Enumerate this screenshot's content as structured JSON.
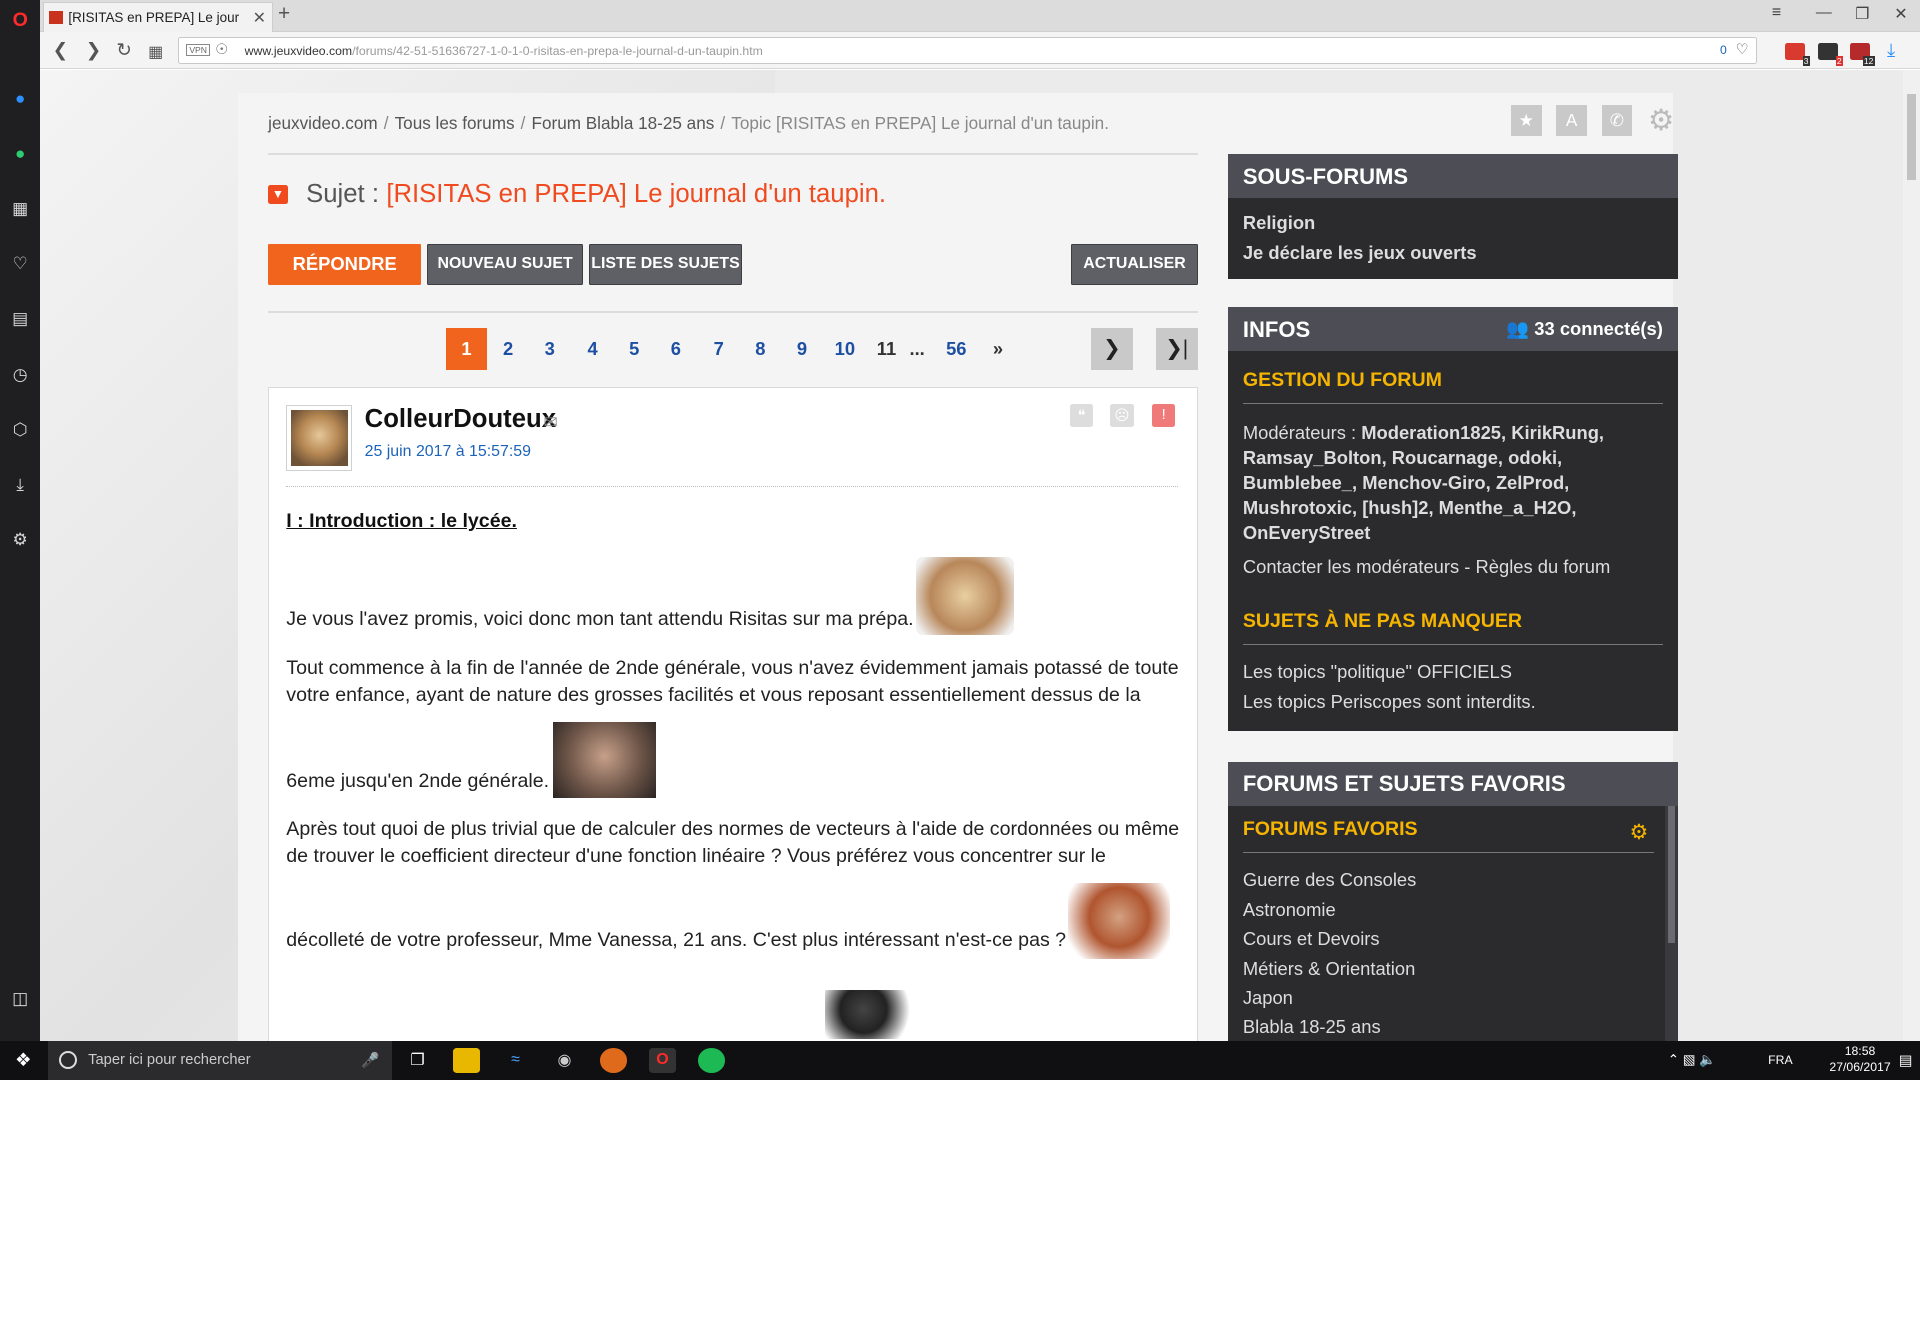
{
  "browser": {
    "tab_title": "[RISITAS en PREPA] Le jour",
    "url_domain": "www.jeuxvideo.com",
    "url_path": "/forums/42-51-51636727-1-0-1-0-risitas-en-prepa-le-journal-d-un-taupin.htm",
    "vpn_label": "VPN",
    "adblock_count": "0",
    "ext_badges": [
      "3",
      "2",
      "12"
    ]
  },
  "breadcrumb": {
    "items": [
      "jeuxvideo.com",
      "Tous les forums",
      "Forum Blabla 18-25 ans"
    ],
    "current": "Topic [RISITAS en PREPA] Le journal d'un taupin.",
    "separator": "/"
  },
  "topic": {
    "subject_label": "Sujet :",
    "subject_title": "[RISITAS en PREPA] Le journal d'un taupin."
  },
  "actions": {
    "reply": "RÉPONDRE",
    "new_topic": "NOUVEAU SUJET",
    "list": "LISTE DES SUJETS",
    "refresh": "ACTUALISER"
  },
  "pagination": {
    "current": 1,
    "pages": [
      "1",
      "2",
      "3",
      "4",
      "5",
      "6",
      "7",
      "8",
      "9",
      "10",
      "11",
      "...",
      "56",
      "»"
    ]
  },
  "post": {
    "author": "ColleurDouteux",
    "date": "25 juin 2017 à 15:57:59",
    "heading": "I : Introduction : le lycée.",
    "p1": "Je vous l'avez promis, voici donc mon tant attendu Risitas sur ma prépa.",
    "p2a": "Tout commence à la fin de l'année de 2nde générale, vous n'avez évidemment jamais potassé de toute votre enfance, ayant de nature des grosses facilités et vous reposant essentiellement dessus de la",
    "p2b": "6eme jusqu'en 2nde générale.",
    "p3a": "Après tout quoi de plus trivial que de calculer des normes de vecteurs à l'aide de cordonnées ou même de trouver le coefficient directeur d'une fonction linéaire ? Vous préférez vous concentrer sur le",
    "p3b": "décolleté de votre professeur, Mme Vanessa, 21 ans. C'est plus intéressant n'est-ce pas ?"
  },
  "sidebar": {
    "sous_forums": {
      "title": "SOUS-FORUMS",
      "items": [
        "Religion",
        "Je déclare les jeux ouverts"
      ]
    },
    "infos": {
      "title": "INFOS",
      "connected": "33 connecté(s)",
      "gestion_title": "GESTION DU FORUM",
      "mods_label": "Modérateurs :",
      "mods_line1": "Moderation1825, KirikRung,",
      "mods_line2": "Ramsay_Bolton, Roucarnage, odoki,",
      "mods_line3": "Bumblebee_, Menchov-Giro, ZelProd,",
      "mods_line4": "Mushrotoxic, [hush]2, Menthe_a_H2O,",
      "mods_line5": "OnEveryStreet",
      "contact": "Contacter les modérateurs",
      "rules_sep": "-",
      "rules": "Règles du forum",
      "must_title": "SUJETS À NE PAS MANQUER",
      "must_items": [
        "Les topics \"politique\" OFFICIELS",
        "Les topics Periscopes sont interdits."
      ]
    },
    "favoris": {
      "title": "FORUMS ET SUJETS FAVORIS",
      "sub_title": "FORUMS FAVORIS",
      "items": [
        "Guerre des Consoles",
        "Astronomie",
        "Cours et Devoirs",
        "Métiers & Orientation",
        "Japon",
        "Blabla 18-25 ans"
      ]
    }
  },
  "taskbar": {
    "search_placeholder": "Taper ici pour rechercher",
    "lang": "FRA",
    "time": "18:58",
    "date": "27/06/2017"
  },
  "colors": {
    "accent": "#f0641e",
    "link": "#1d63b8",
    "sidebar_yellow": "#f5b400"
  }
}
